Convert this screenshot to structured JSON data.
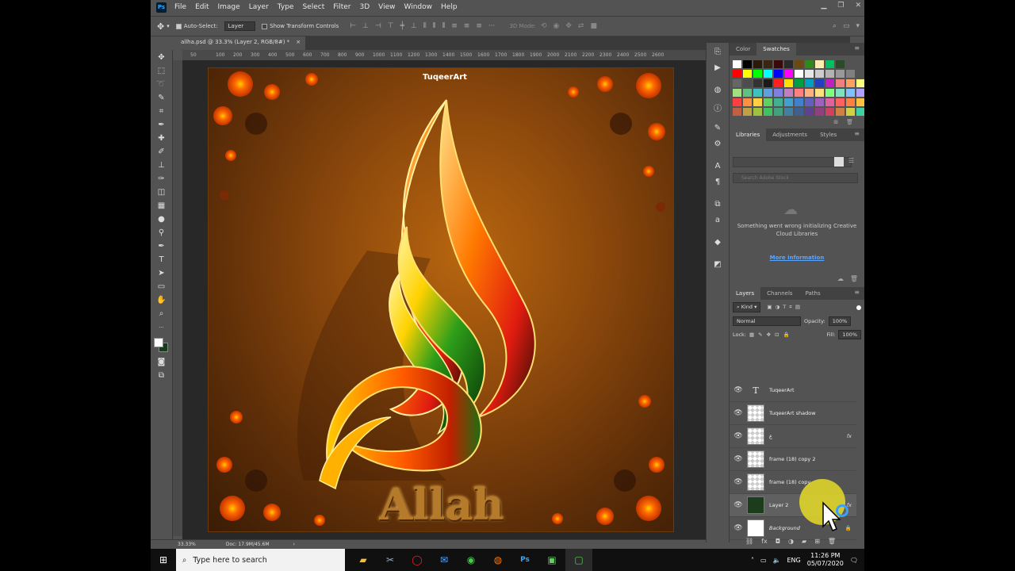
{
  "app": {
    "logo": "Ps"
  },
  "menu": [
    "File",
    "Edit",
    "Image",
    "Layer",
    "Type",
    "Select",
    "Filter",
    "3D",
    "View",
    "Window",
    "Help"
  ],
  "options_bar": {
    "auto_select_label": "Auto-Select:",
    "auto_select_value": "Layer",
    "show_transform_label": "Show Transform Controls",
    "mode_3d_label": "3D Mode:"
  },
  "document_tab": {
    "title": "allha.psd @ 33.3% (Layer 2, RGB/8#) *",
    "close": "×"
  },
  "ruler_ticks": [
    "50",
    "0",
    "50",
    "100",
    "150",
    "200",
    "250",
    "300",
    "350",
    "400",
    "450",
    "500",
    "550",
    "600",
    "650",
    "700",
    "750",
    "800",
    "850",
    "900",
    "950",
    "1000",
    "1050",
    "1100",
    "1150",
    "1200",
    "1250",
    "1300",
    "1350",
    "1400",
    "1450",
    "1500",
    "1550",
    "1600",
    "1650",
    "1700",
    "1750",
    "1800",
    "1850",
    "1900",
    "1950",
    "2000",
    "2050",
    "2100",
    "2150",
    "2200",
    "2250",
    "2300",
    "2350",
    "2400",
    "2450",
    "2500",
    "2550",
    "2600"
  ],
  "artwork": {
    "watermark": "TuqeerArt",
    "word": "Allah"
  },
  "status": {
    "zoom": "33.33%",
    "doc": "Doc: 17.9M/45.6M"
  },
  "panels": {
    "color_tabs": [
      "Color",
      "Swatches"
    ],
    "library_tabs": [
      "Libraries",
      "Adjustments",
      "Styles"
    ],
    "library_search_placeholder": "Search Adobe Stock",
    "library_error": "Something went wrong initializing Creative Cloud Libraries",
    "library_link": "More information",
    "layers_tabs": [
      "Layers",
      "Channels",
      "Paths"
    ],
    "kind_label": "Kind",
    "blend_mode": "Normal",
    "opacity_label": "Opacity:",
    "opacity_value": "100%",
    "lock_label": "Lock:",
    "fill_label": "Fill:",
    "fill_value": "100%"
  },
  "layers": [
    {
      "name": "TuqeerArt",
      "type": "text",
      "fx": ""
    },
    {
      "name": "TuqeerArt shadow",
      "type": "pixel",
      "fx": ""
    },
    {
      "name": "ع",
      "type": "pixel",
      "fx": "fx"
    },
    {
      "name": "frame (18) copy 2",
      "type": "pixel",
      "fx": ""
    },
    {
      "name": "frame (18) copy",
      "type": "pixel",
      "fx": ""
    },
    {
      "name": "Layer 2",
      "type": "fill",
      "fx": "fx"
    },
    {
      "name": "Background",
      "type": "bg",
      "fx": ""
    }
  ],
  "taskbar": {
    "search_placeholder": "Type here to search",
    "lang": "ENG",
    "time": "11:26 PM",
    "date": "05/07/2020"
  },
  "colors": {
    "accent": "#31a8ff",
    "ui_bg": "#535353",
    "link": "#5aa5ff",
    "halo": "#e6dc28"
  }
}
